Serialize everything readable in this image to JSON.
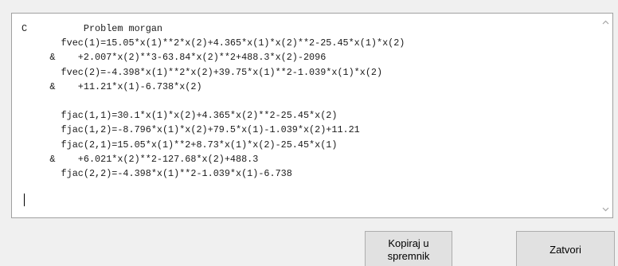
{
  "editor": {
    "lines": [
      "C          Problem morgan",
      "       fvec(1)=15.05*x(1)**2*x(2)+4.365*x(1)*x(2)**2-25.45*x(1)*x(2)",
      "     &    +2.007*x(2)**3-63.84*x(2)**2+488.3*x(2)-2096",
      "       fvec(2)=-4.398*x(1)**2*x(2)+39.75*x(1)**2-1.039*x(1)*x(2)",
      "     &    +11.21*x(1)-6.738*x(2)",
      "",
      "       fjac(1,1)=30.1*x(1)*x(2)+4.365*x(2)**2-25.45*x(2)",
      "       fjac(1,2)=-8.796*x(1)*x(2)+79.5*x(1)-1.039*x(2)+11.21",
      "       fjac(2,1)=15.05*x(1)**2+8.73*x(1)*x(2)-25.45*x(1)",
      "     &    +6.021*x(2)**2-127.68*x(2)+488.3",
      "       fjac(2,2)=-4.398*x(1)**2-1.039*x(1)-6.738"
    ],
    "scroll_up_icon": "chevron-up-icon",
    "scroll_down_icon": "chevron-down-icon"
  },
  "buttons": {
    "copy_label": "Kopiraj u\nspremnik",
    "close_label": "Zatvori"
  },
  "colors": {
    "background": "#f0f0f0",
    "editor_bg": "#ffffff",
    "button_bg": "#e1e1e1",
    "button_border": "#adadad",
    "text": "#1a1a1a"
  }
}
